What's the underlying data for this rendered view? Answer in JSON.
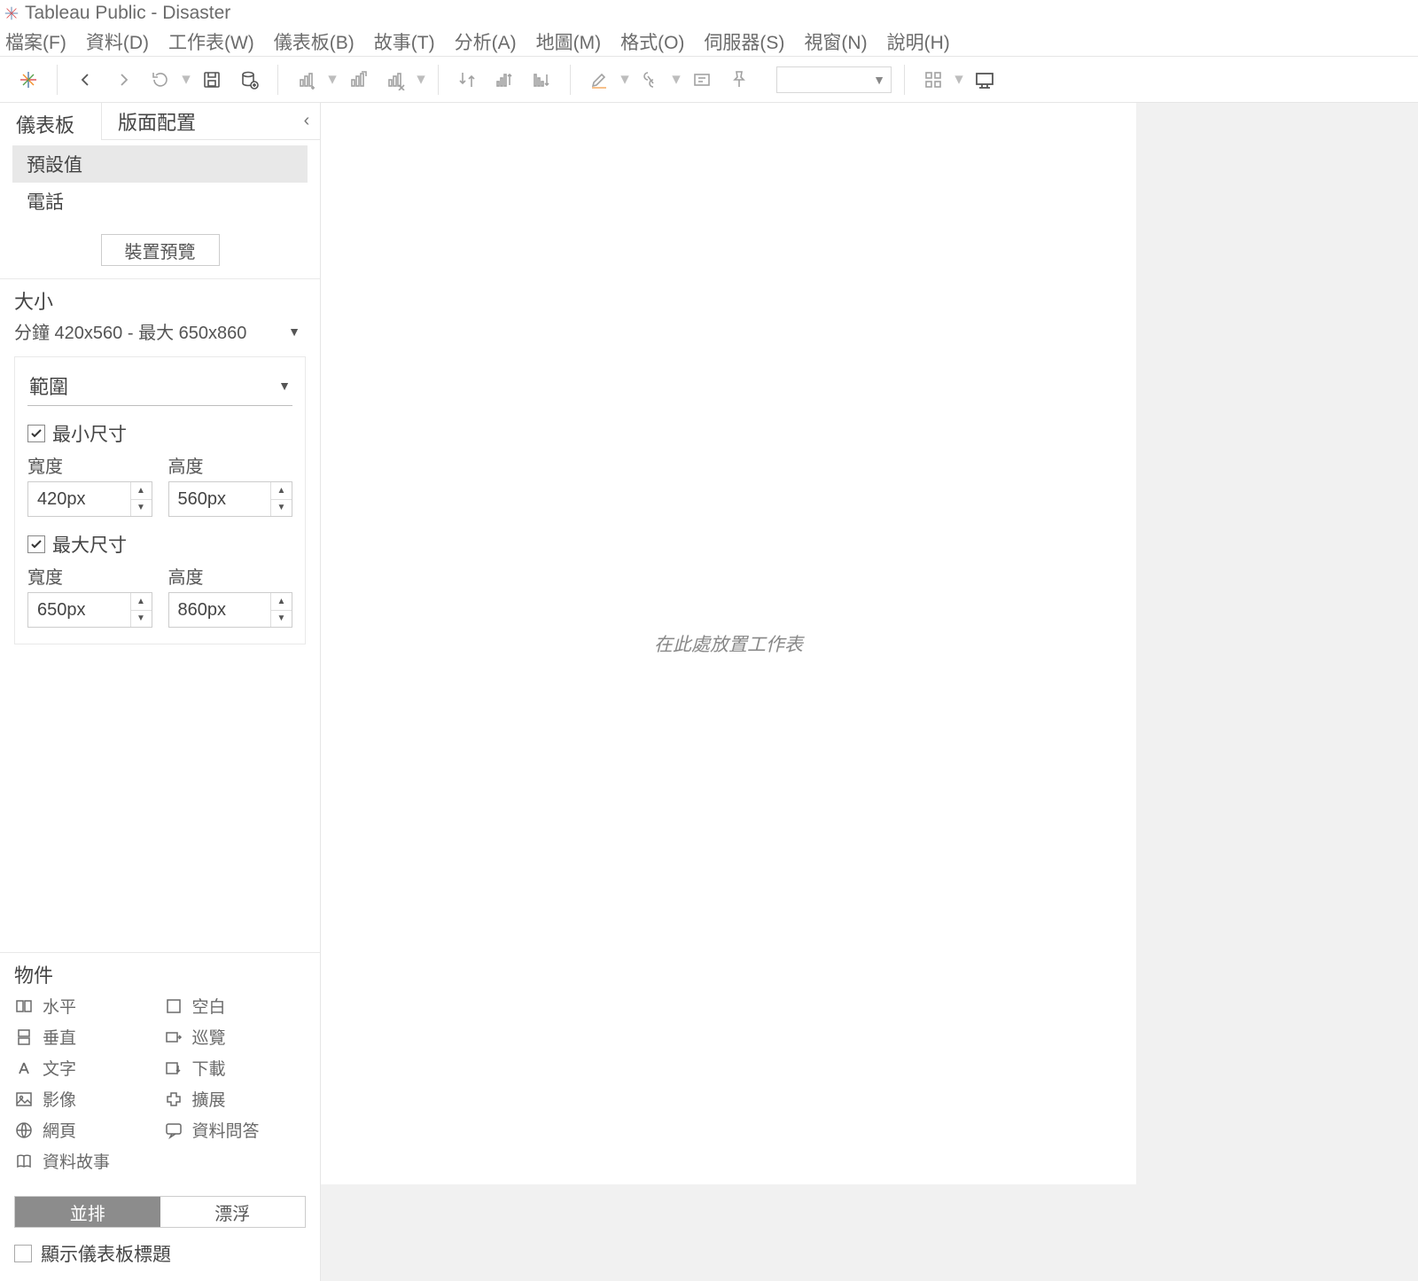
{
  "title": "Tableau Public - Disaster",
  "menu": [
    "檔案(F)",
    "資料(D)",
    "工作表(W)",
    "儀表板(B)",
    "故事(T)",
    "分析(A)",
    "地圖(M)",
    "格式(O)",
    "伺服器(S)",
    "視窗(N)",
    "說明(H)"
  ],
  "leftTabs": {
    "dashboard": "儀表板",
    "layout": "版面配置"
  },
  "devices": {
    "default": "預設值",
    "phone": "電話",
    "previewBtn": "裝置預覽"
  },
  "size": {
    "title": "大小",
    "summary": "分鐘 420x560 - 最大 650x860",
    "rangeLabel": "範圍",
    "minLabel": "最小尺寸",
    "maxLabel": "最大尺寸",
    "widthLabel": "寬度",
    "heightLabel": "高度",
    "minW": "420px",
    "minH": "560px",
    "maxW": "650px",
    "maxH": "860px"
  },
  "objects": {
    "title": "物件",
    "items": {
      "horizontal": "水平",
      "blank": "空白",
      "vertical": "垂直",
      "navigate": "巡覽",
      "text": "文字",
      "download": "下載",
      "image": "影像",
      "extension": "擴展",
      "web": "網頁",
      "askdata": "資料問答",
      "datastory": "資料故事"
    }
  },
  "tilefloat": {
    "tile": "並排",
    "float": "漂浮"
  },
  "showTitle": "顯示儀表板標題",
  "canvasPlaceholder": "在此處放置工作表"
}
